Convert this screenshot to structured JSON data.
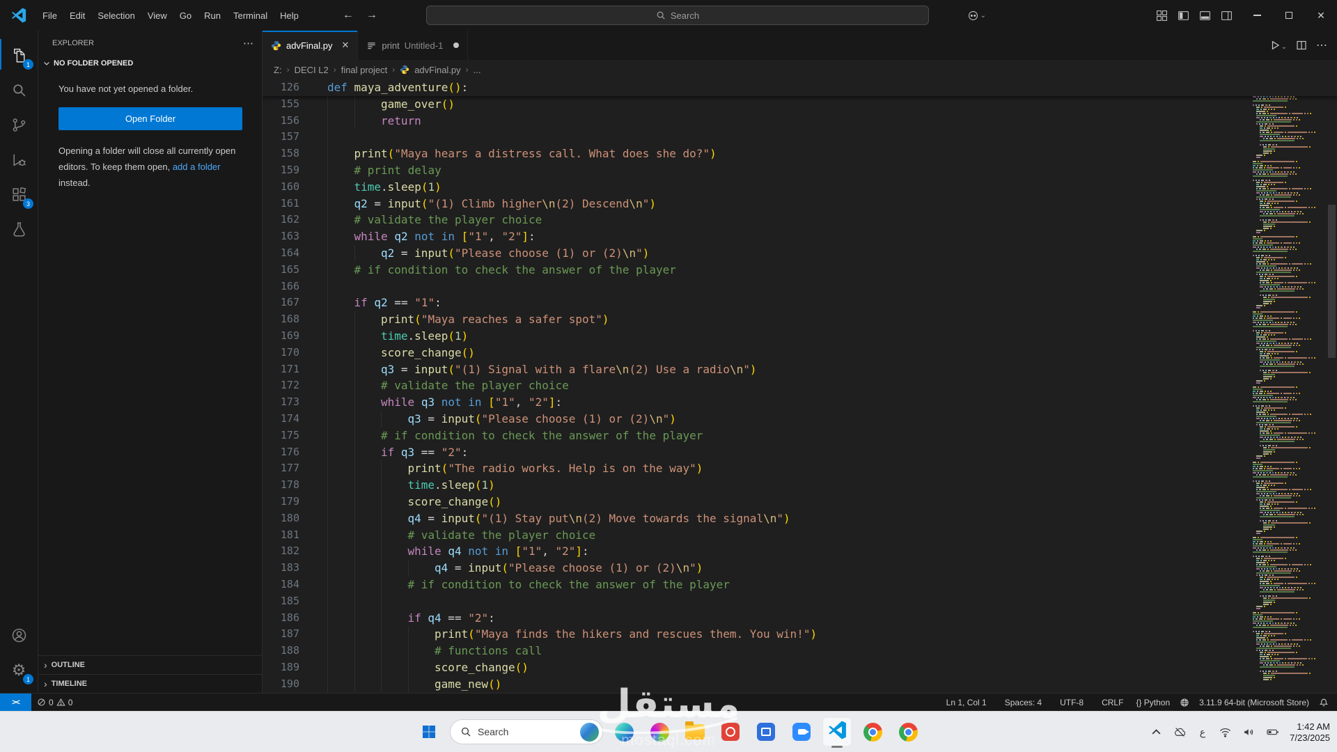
{
  "titlebar": {
    "menus": [
      "File",
      "Edit",
      "Selection",
      "View",
      "Go",
      "Run",
      "Terminal",
      "Help"
    ],
    "back_arrow": "←",
    "forward_arrow": "→",
    "search_placeholder": "Search",
    "window_controls": {
      "minimize": "minimize",
      "maximize": "maximize",
      "close": "✕"
    }
  },
  "activity_bar": {
    "top_items": [
      {
        "name": "explorer",
        "badge": "1",
        "active": true
      },
      {
        "name": "search"
      },
      {
        "name": "source-control"
      },
      {
        "name": "run-debug"
      },
      {
        "name": "extensions",
        "badge": "3"
      },
      {
        "name": "testing"
      }
    ],
    "bottom_items": [
      {
        "name": "account"
      },
      {
        "name": "settings",
        "badge": "1"
      }
    ]
  },
  "sidebar": {
    "title": "EXPLORER",
    "more_icon": "⋯",
    "section_label": "NO FOLDER OPENED",
    "empty_text": "You have not yet opened a folder.",
    "open_folder_label": "Open Folder",
    "note_before": "Opening a folder will close all currently open editors. To keep them open,",
    "note_link": "add a folder",
    "note_after": " instead.",
    "outline_label": "OUTLINE",
    "timeline_label": "TIMELINE"
  },
  "tabs": [
    {
      "label": "advFinal.py",
      "icon": "python",
      "active": true,
      "close_glyph": "✕"
    },
    {
      "label": "print",
      "sublabel": "Untitled-1",
      "icon": "list",
      "modified": true
    }
  ],
  "tab_actions": {
    "run": "run-python-file",
    "split": "split-editor",
    "more": "⋯"
  },
  "breadcrumb": {
    "items": [
      "Z:",
      "DECI L2",
      "final project",
      "advFinal.py",
      "..."
    ],
    "separator": "›"
  },
  "editor": {
    "sticky": {
      "n": "126",
      "indent": 0,
      "tokens": [
        [
          "kw",
          "def"
        ],
        [
          "txt",
          " "
        ],
        [
          "fn",
          "maya_adventure"
        ],
        [
          "brk",
          "()"
        ],
        [
          "op",
          ":"
        ]
      ]
    },
    "lines": [
      {
        "n": "155",
        "indent": 2,
        "tokens": [
          [
            "fn",
            "game_over"
          ],
          [
            "brk",
            "()"
          ]
        ]
      },
      {
        "n": "156",
        "indent": 2,
        "tokens": [
          [
            "ctrl",
            "return"
          ]
        ]
      },
      {
        "n": "157",
        "indent": 1,
        "tokens": []
      },
      {
        "n": "158",
        "indent": 1,
        "tokens": [
          [
            "fn",
            "print"
          ],
          [
            "brk",
            "("
          ],
          [
            "str",
            "\"Maya hears a distress call. What does she do?\""
          ],
          [
            "brk",
            ")"
          ]
        ]
      },
      {
        "n": "159",
        "indent": 1,
        "tokens": [
          [
            "com",
            "# print delay"
          ]
        ]
      },
      {
        "n": "160",
        "indent": 1,
        "tokens": [
          [
            "cls",
            "time"
          ],
          [
            "op",
            "."
          ],
          [
            "fn",
            "sleep"
          ],
          [
            "brk",
            "("
          ],
          [
            "num",
            "1"
          ],
          [
            "brk",
            ")"
          ]
        ]
      },
      {
        "n": "161",
        "indent": 1,
        "tokens": [
          [
            "var",
            "q2"
          ],
          [
            "op",
            " = "
          ],
          [
            "fn",
            "input"
          ],
          [
            "brk",
            "("
          ],
          [
            "str",
            "\"(1) Climb higher"
          ],
          [
            "esc",
            "\\n"
          ],
          [
            "str",
            "(2) Descend"
          ],
          [
            "esc",
            "\\n"
          ],
          [
            "str",
            "\""
          ],
          [
            "brk",
            ")"
          ]
        ]
      },
      {
        "n": "162",
        "indent": 1,
        "tokens": [
          [
            "com",
            "# validate the player choice"
          ]
        ]
      },
      {
        "n": "163",
        "indent": 1,
        "tokens": [
          [
            "ctrl",
            "while"
          ],
          [
            "txt",
            " "
          ],
          [
            "var",
            "q2"
          ],
          [
            "txt",
            " "
          ],
          [
            "kw",
            "not"
          ],
          [
            "txt",
            " "
          ],
          [
            "kw",
            "in"
          ],
          [
            "txt",
            " "
          ],
          [
            "brk",
            "["
          ],
          [
            "str",
            "\"1\""
          ],
          [
            "op",
            ", "
          ],
          [
            "str",
            "\"2\""
          ],
          [
            "brk",
            "]"
          ],
          [
            "op",
            ":"
          ]
        ]
      },
      {
        "n": "164",
        "indent": 2,
        "tokens": [
          [
            "var",
            "q2"
          ],
          [
            "op",
            " = "
          ],
          [
            "fn",
            "input"
          ],
          [
            "brk",
            "("
          ],
          [
            "str",
            "\"Please choose (1) or (2)"
          ],
          [
            "esc",
            "\\n"
          ],
          [
            "str",
            "\""
          ],
          [
            "brk",
            ")"
          ]
        ]
      },
      {
        "n": "165",
        "indent": 1,
        "tokens": [
          [
            "com",
            "# if condition to check the answer of the player"
          ]
        ]
      },
      {
        "n": "166",
        "indent": 1,
        "tokens": []
      },
      {
        "n": "167",
        "indent": 1,
        "tokens": [
          [
            "ctrl",
            "if"
          ],
          [
            "txt",
            " "
          ],
          [
            "var",
            "q2"
          ],
          [
            "op",
            " == "
          ],
          [
            "str",
            "\"1\""
          ],
          [
            "op",
            ":"
          ]
        ]
      },
      {
        "n": "168",
        "indent": 2,
        "tokens": [
          [
            "fn",
            "print"
          ],
          [
            "brk",
            "("
          ],
          [
            "str",
            "\"Maya reaches a safer spot\""
          ],
          [
            "brk",
            ")"
          ]
        ]
      },
      {
        "n": "169",
        "indent": 2,
        "tokens": [
          [
            "cls",
            "time"
          ],
          [
            "op",
            "."
          ],
          [
            "fn",
            "sleep"
          ],
          [
            "brk",
            "("
          ],
          [
            "num",
            "1"
          ],
          [
            "brk",
            ")"
          ]
        ]
      },
      {
        "n": "170",
        "indent": 2,
        "tokens": [
          [
            "fn",
            "score_change"
          ],
          [
            "brk",
            "()"
          ]
        ]
      },
      {
        "n": "171",
        "indent": 2,
        "tokens": [
          [
            "var",
            "q3"
          ],
          [
            "op",
            " = "
          ],
          [
            "fn",
            "input"
          ],
          [
            "brk",
            "("
          ],
          [
            "str",
            "\"(1) Signal with a flare"
          ],
          [
            "esc",
            "\\n"
          ],
          [
            "str",
            "(2) Use a radio"
          ],
          [
            "esc",
            "\\n"
          ],
          [
            "str",
            "\""
          ],
          [
            "brk",
            ")"
          ]
        ]
      },
      {
        "n": "172",
        "indent": 2,
        "tokens": [
          [
            "com",
            "# validate the player choice"
          ]
        ]
      },
      {
        "n": "173",
        "indent": 2,
        "tokens": [
          [
            "ctrl",
            "while"
          ],
          [
            "txt",
            " "
          ],
          [
            "var",
            "q3"
          ],
          [
            "txt",
            " "
          ],
          [
            "kw",
            "not"
          ],
          [
            "txt",
            " "
          ],
          [
            "kw",
            "in"
          ],
          [
            "txt",
            " "
          ],
          [
            "brk",
            "["
          ],
          [
            "str",
            "\"1\""
          ],
          [
            "op",
            ", "
          ],
          [
            "str",
            "\"2\""
          ],
          [
            "brk",
            "]"
          ],
          [
            "op",
            ":"
          ]
        ]
      },
      {
        "n": "174",
        "indent": 3,
        "tokens": [
          [
            "var",
            "q3"
          ],
          [
            "op",
            " = "
          ],
          [
            "fn",
            "input"
          ],
          [
            "brk",
            "("
          ],
          [
            "str",
            "\"Please choose (1) or (2)"
          ],
          [
            "esc",
            "\\n"
          ],
          [
            "str",
            "\""
          ],
          [
            "brk",
            ")"
          ]
        ]
      },
      {
        "n": "175",
        "indent": 2,
        "tokens": [
          [
            "com",
            "# if condition to check the answer of the player"
          ]
        ]
      },
      {
        "n": "176",
        "indent": 2,
        "tokens": [
          [
            "ctrl",
            "if"
          ],
          [
            "txt",
            " "
          ],
          [
            "var",
            "q3"
          ],
          [
            "op",
            " == "
          ],
          [
            "str",
            "\"2\""
          ],
          [
            "op",
            ":"
          ]
        ]
      },
      {
        "n": "177",
        "indent": 3,
        "tokens": [
          [
            "fn",
            "print"
          ],
          [
            "brk",
            "("
          ],
          [
            "str",
            "\"The radio works. Help is on the way\""
          ],
          [
            "brk",
            ")"
          ]
        ]
      },
      {
        "n": "178",
        "indent": 3,
        "tokens": [
          [
            "cls",
            "time"
          ],
          [
            "op",
            "."
          ],
          [
            "fn",
            "sleep"
          ],
          [
            "brk",
            "("
          ],
          [
            "num",
            "1"
          ],
          [
            "brk",
            ")"
          ]
        ]
      },
      {
        "n": "179",
        "indent": 3,
        "tokens": [
          [
            "fn",
            "score_change"
          ],
          [
            "brk",
            "()"
          ]
        ]
      },
      {
        "n": "180",
        "indent": 3,
        "tokens": [
          [
            "var",
            "q4"
          ],
          [
            "op",
            " = "
          ],
          [
            "fn",
            "input"
          ],
          [
            "brk",
            "("
          ],
          [
            "str",
            "\"(1) Stay put"
          ],
          [
            "esc",
            "\\n"
          ],
          [
            "str",
            "(2) Move towards the signal"
          ],
          [
            "esc",
            "\\n"
          ],
          [
            "str",
            "\""
          ],
          [
            "brk",
            ")"
          ]
        ]
      },
      {
        "n": "181",
        "indent": 3,
        "tokens": [
          [
            "com",
            "# validate the player choice"
          ]
        ]
      },
      {
        "n": "182",
        "indent": 3,
        "tokens": [
          [
            "ctrl",
            "while"
          ],
          [
            "txt",
            " "
          ],
          [
            "var",
            "q4"
          ],
          [
            "txt",
            " "
          ],
          [
            "kw",
            "not"
          ],
          [
            "txt",
            " "
          ],
          [
            "kw",
            "in"
          ],
          [
            "txt",
            " "
          ],
          [
            "brk",
            "["
          ],
          [
            "str",
            "\"1\""
          ],
          [
            "op",
            ", "
          ],
          [
            "str",
            "\"2\""
          ],
          [
            "brk",
            "]"
          ],
          [
            "op",
            ":"
          ]
        ]
      },
      {
        "n": "183",
        "indent": 4,
        "tokens": [
          [
            "var",
            "q4"
          ],
          [
            "op",
            " = "
          ],
          [
            "fn",
            "input"
          ],
          [
            "brk",
            "("
          ],
          [
            "str",
            "\"Please choose (1) or (2)"
          ],
          [
            "esc",
            "\\n"
          ],
          [
            "str",
            "\""
          ],
          [
            "brk",
            ")"
          ]
        ]
      },
      {
        "n": "184",
        "indent": 3,
        "tokens": [
          [
            "com",
            "# if condition to check the answer of the player"
          ]
        ]
      },
      {
        "n": "185",
        "indent": 3,
        "tokens": []
      },
      {
        "n": "186",
        "indent": 3,
        "tokens": [
          [
            "ctrl",
            "if"
          ],
          [
            "txt",
            " "
          ],
          [
            "var",
            "q4"
          ],
          [
            "op",
            " == "
          ],
          [
            "str",
            "\"2\""
          ],
          [
            "op",
            ":"
          ]
        ]
      },
      {
        "n": "187",
        "indent": 4,
        "tokens": [
          [
            "fn",
            "print"
          ],
          [
            "brk",
            "("
          ],
          [
            "str",
            "\"Maya finds the hikers and rescues them. You win!\""
          ],
          [
            "brk",
            ")"
          ]
        ]
      },
      {
        "n": "188",
        "indent": 4,
        "tokens": [
          [
            "com",
            "# functions call"
          ]
        ]
      },
      {
        "n": "189",
        "indent": 4,
        "tokens": [
          [
            "fn",
            "score_change"
          ],
          [
            "brk",
            "()"
          ]
        ]
      },
      {
        "n": "190",
        "indent": 4,
        "tokens": [
          [
            "fn",
            "game_new"
          ],
          [
            "brk",
            "()"
          ]
        ]
      }
    ]
  },
  "statusbar": {
    "remote_glyph": "><",
    "errors": "0",
    "warnings": "0",
    "items": [
      "Ln 1, Col 1",
      "Spaces: 4",
      "UTF-8",
      "CRLF"
    ],
    "language_icon": "{}",
    "language_label": "Python",
    "interpreter": "3.11.9 64-bit (Microsoft Store)"
  },
  "taskbar": {
    "search_label": "Search",
    "app_icons": [
      {
        "name": "edge"
      },
      {
        "name": "copilot"
      },
      {
        "name": "file-explorer"
      },
      {
        "name": "app-red"
      },
      {
        "name": "app-blue"
      },
      {
        "name": "zoom"
      },
      {
        "name": "vscode",
        "active": true
      },
      {
        "name": "chrome"
      },
      {
        "name": "chrome-2"
      }
    ],
    "tray_language": "ع",
    "clock_time": "1:42 AM",
    "clock_date": "7/23/2025"
  },
  "watermark": {
    "arabic": "مستقل",
    "domain": "mostaql.com"
  },
  "colors": {
    "accent": "#0078d4",
    "titlebar_bg": "#181818",
    "sidebar_bg": "#181818",
    "editor_bg": "#1f1f1f",
    "taskbar_bg": "#e9ebee",
    "token_keyword": "#569cd6",
    "token_control": "#c586c0",
    "token_function": "#dcdcaa",
    "token_variable": "#9cdcfe",
    "token_string": "#ce9178",
    "token_escape": "#d7ba7d",
    "token_number": "#b5cea8",
    "token_comment": "#6a9955",
    "token_bracket": "#ffd700",
    "token_class": "#4ec9b0"
  }
}
